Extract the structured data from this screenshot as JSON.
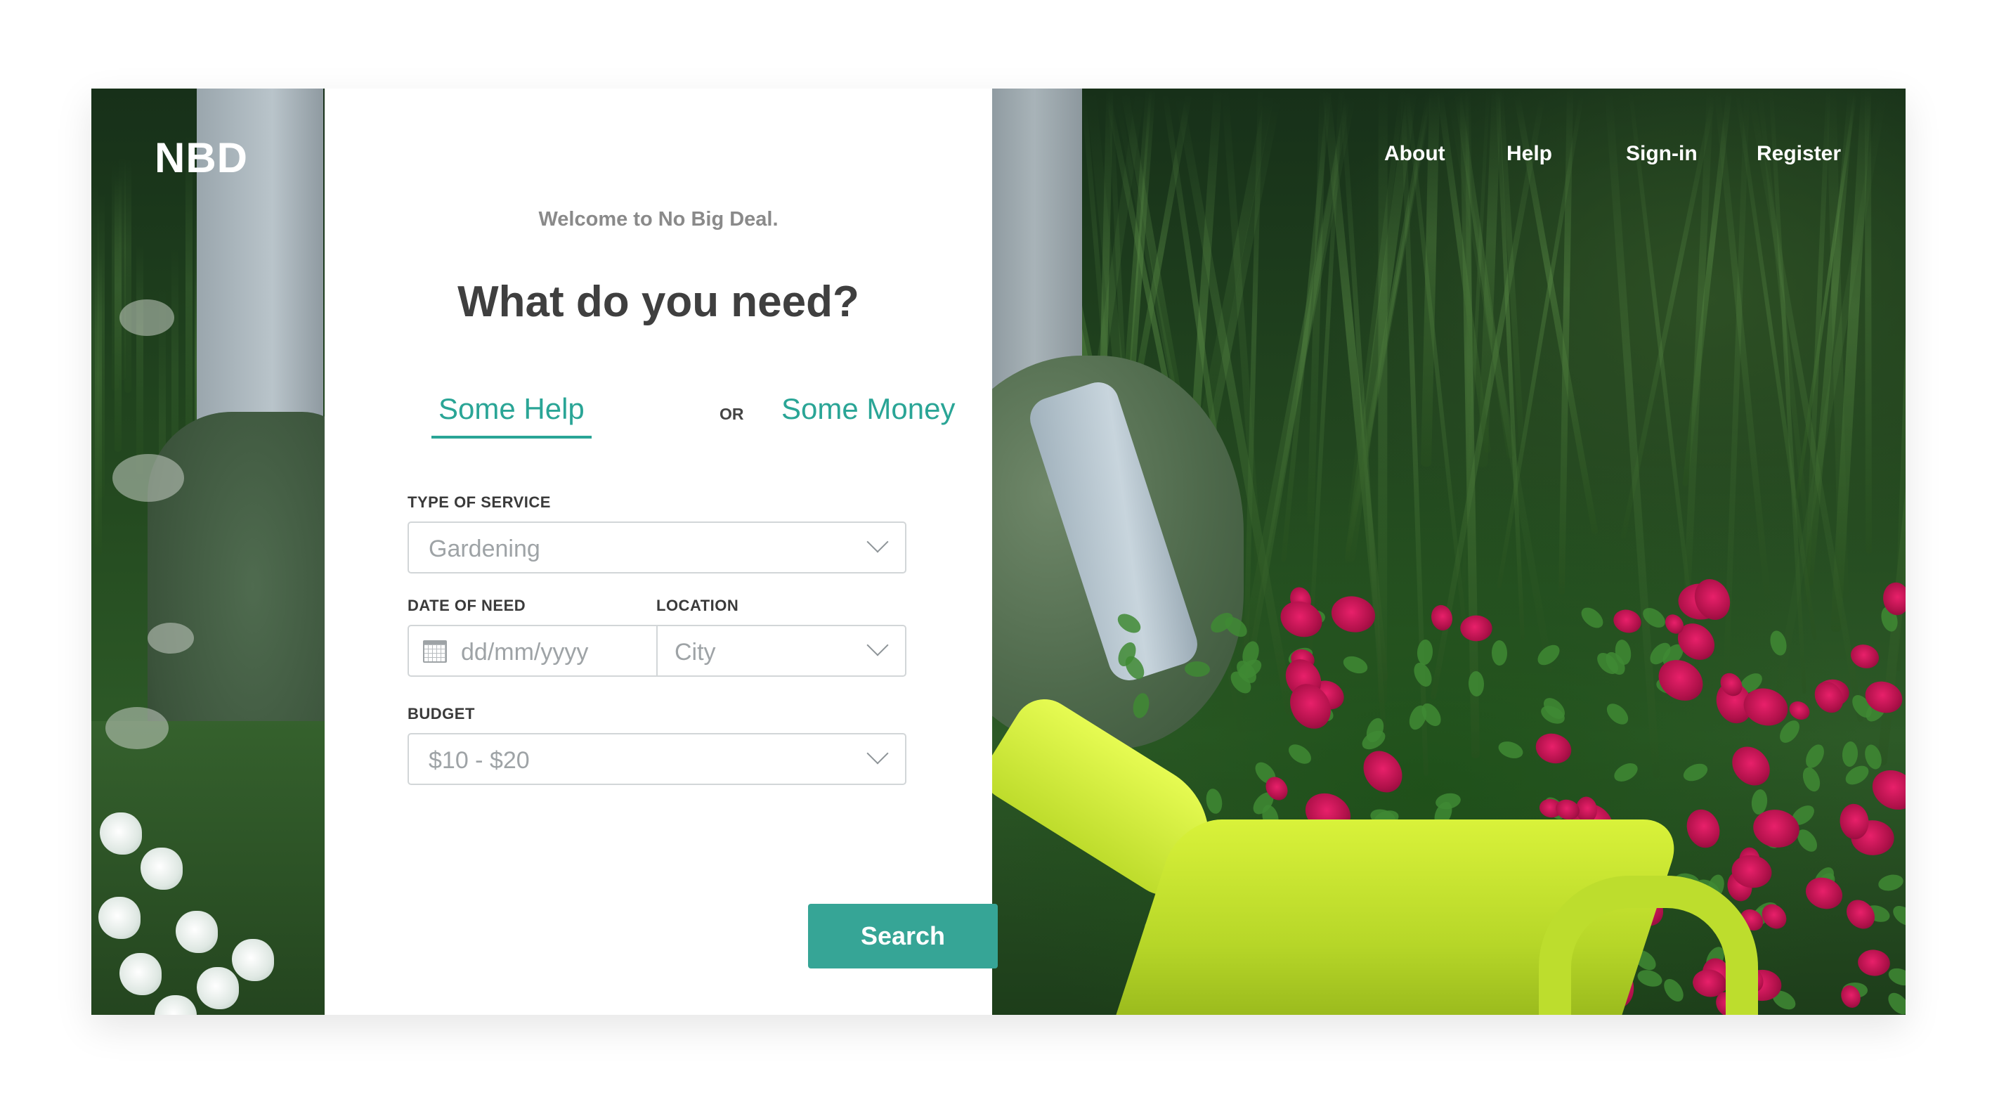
{
  "brand": {
    "logo": "NBD"
  },
  "nav": {
    "items": [
      "About",
      "Help",
      "Sign-in",
      "Register"
    ]
  },
  "card": {
    "welcome": "Welcome to No Big Deal.",
    "title": "What do you need?",
    "options": {
      "first": "Some Help",
      "separator": "OR",
      "second": "Some Money",
      "selected": "Some Help"
    }
  },
  "form": {
    "service": {
      "label": "TYPE OF SERVICE",
      "value": "Gardening"
    },
    "date": {
      "label": "DATE OF NEED",
      "placeholder": "dd/mm/yyyy"
    },
    "location": {
      "label": "LOCATION",
      "value": "City"
    },
    "budget": {
      "label": "BUDGET",
      "value": "$10 - $20"
    },
    "submit_label": "Search"
  },
  "colors": {
    "accent": "#2aa596",
    "button": "#36a596",
    "text_dark": "#3f3f3f",
    "border": "#d2d6d8"
  },
  "icons": {
    "calendar": "calendar-icon",
    "dropdown": "chevron-down-icon"
  }
}
